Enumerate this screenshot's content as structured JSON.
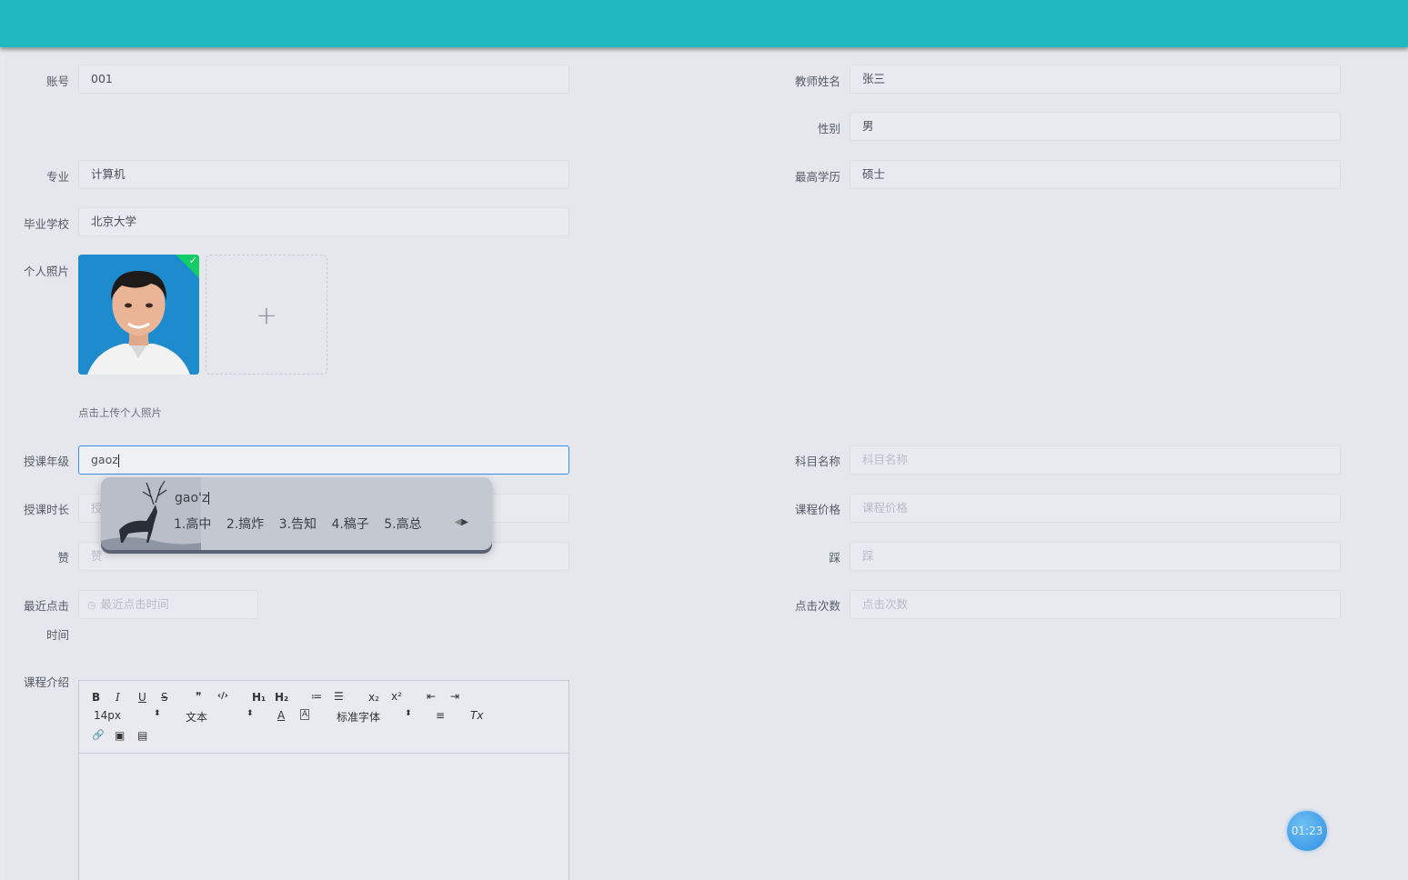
{
  "form": {
    "account": {
      "label": "账号",
      "value": "001"
    },
    "teacher_name": {
      "label": "教师姓名",
      "value": "张三"
    },
    "gender": {
      "label": "性别",
      "value": "男"
    },
    "major": {
      "label": "专业",
      "value": "计算机"
    },
    "education": {
      "label": "最高学历",
      "value": "硕士"
    },
    "school": {
      "label": "毕业学校",
      "value": "北京大学"
    },
    "photo": {
      "label": "个人照片",
      "upload_tip": "点击上传个人照片",
      "plus": "+"
    },
    "grade": {
      "label": "授课年级",
      "value": "gaoz"
    },
    "subject": {
      "label": "科目名称",
      "placeholder": "科目名称"
    },
    "duration": {
      "label": "授课时长",
      "placeholder": "授"
    },
    "price": {
      "label": "课程价格",
      "placeholder": "课程价格"
    },
    "like": {
      "label": "赞",
      "placeholder": "赞"
    },
    "dislike": {
      "label": "踩",
      "placeholder": "踩"
    },
    "last_click": {
      "label_line1": "最近点击",
      "label_line2": "时间",
      "placeholder": "最近点击时间"
    },
    "click_count": {
      "label": "点击次数",
      "placeholder": "点击次数"
    },
    "intro": {
      "label": "课程介绍"
    }
  },
  "ime": {
    "pinyin": "gao'z",
    "candidates": [
      "1.高中",
      "2.搞炸",
      "3.告知",
      "4.稿子",
      "5.高总"
    ]
  },
  "editor_toolbar": {
    "bold": "B",
    "italic": "I",
    "underline": "U",
    "strike": "S",
    "quote": "❞",
    "code": "‹/›",
    "h1": "H₁",
    "h2": "H₂",
    "ol": "≔",
    "ul": "☰",
    "sub": "x₂",
    "sup": "x²",
    "outdent": "⇤",
    "indent": "⇥",
    "size": "14px",
    "header": "文本",
    "font": "标准字体",
    "color": "A",
    "bg": "A",
    "align": "≡",
    "clean": "Tx",
    "link": "🔗",
    "image": "▣",
    "video": "▤"
  },
  "timer": "01:23",
  "colors": {
    "topbar": "#21b8c2",
    "focus": "#3a8ee6",
    "success": "#13ce66"
  }
}
